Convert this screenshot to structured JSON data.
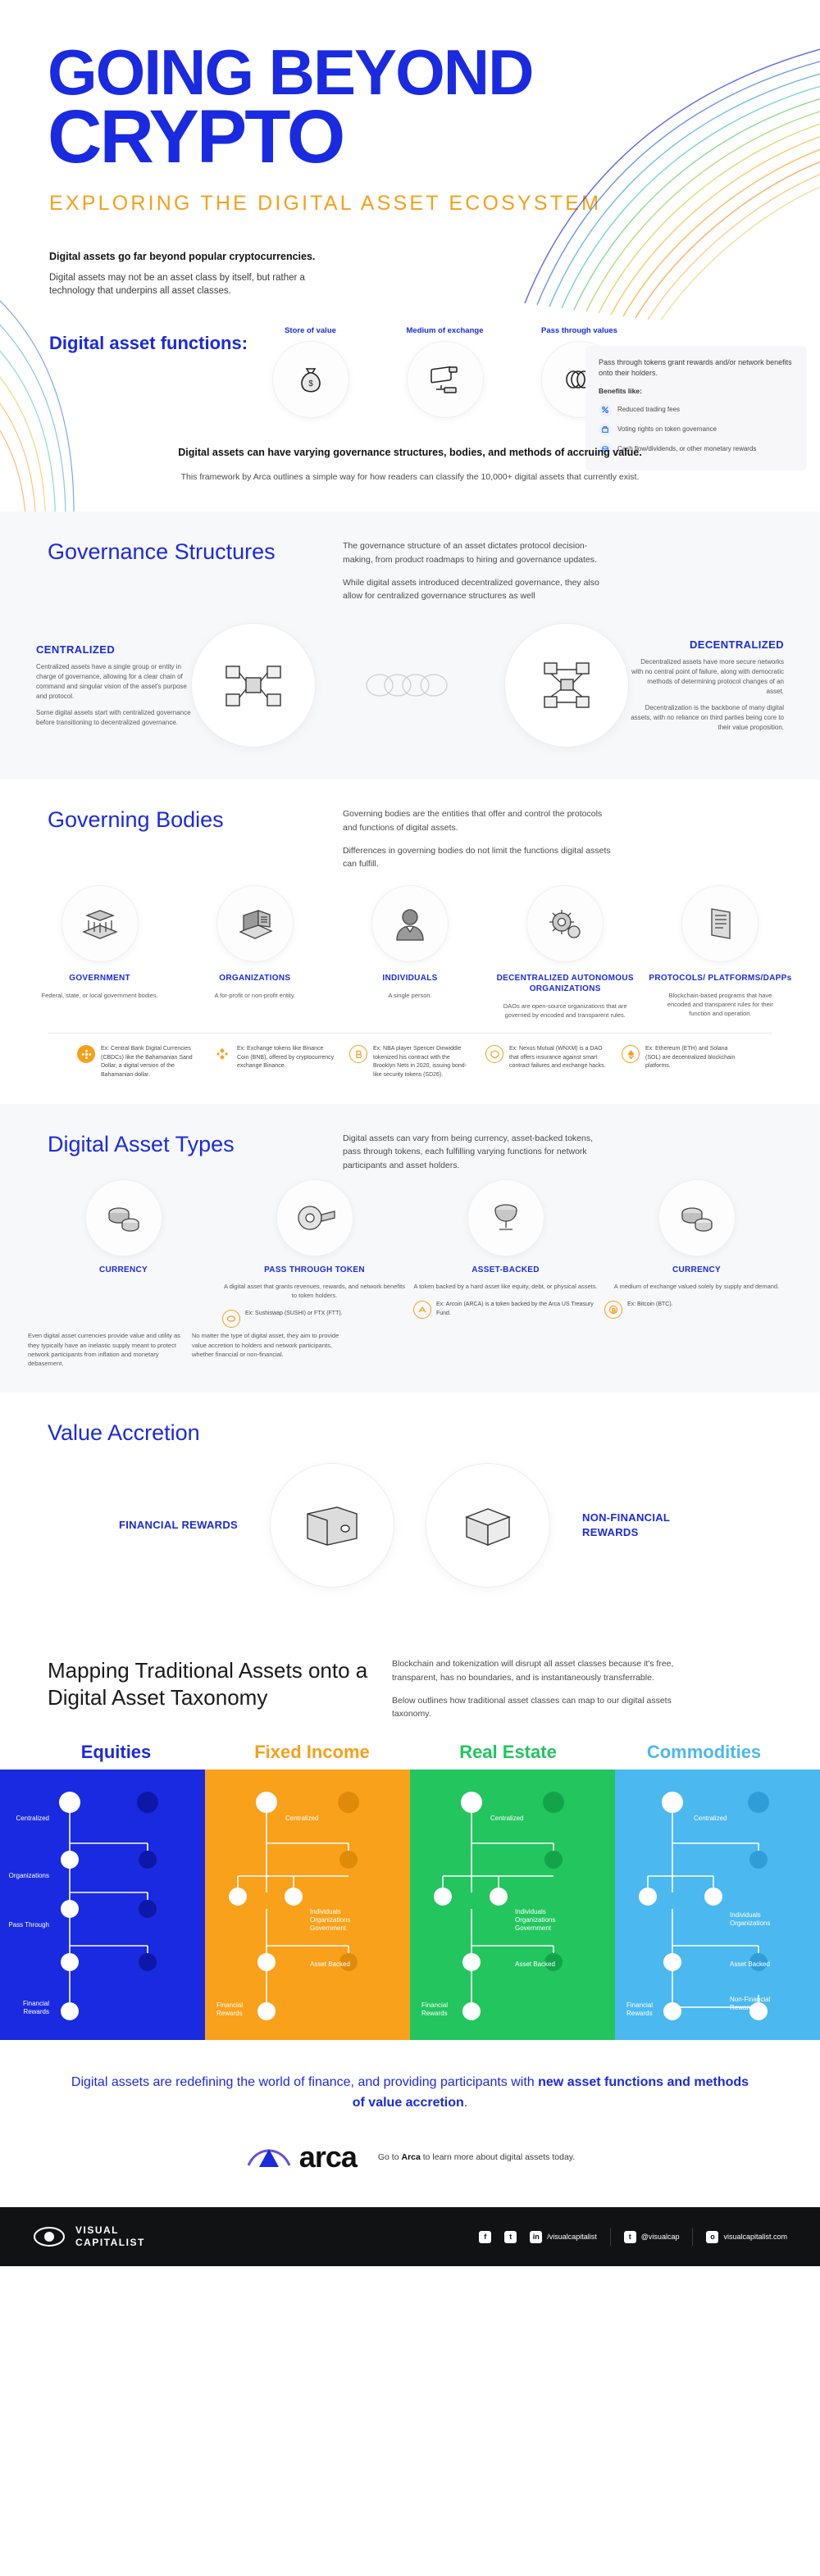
{
  "hero": {
    "title_line1": "GOING BEYOND",
    "title_line2": "CRYPTO",
    "subtitle": "EXPLORING THE DIGITAL ASSET ECOSYSTEM",
    "lead": "Digital assets go far beyond popular cryptocurrencies.",
    "sub": "Digital assets may not be an asset class by itself, but rather a technology that underpins all asset classes."
  },
  "functions": {
    "label": "Digital asset functions:",
    "items": [
      {
        "caption": "Store of value",
        "icon": "money-bag-icon"
      },
      {
        "caption": "Medium of exchange",
        "icon": "monitor-exchange-icon"
      },
      {
        "caption": "Pass through values",
        "icon": "chain-links-icon"
      }
    ],
    "benefits_panel": {
      "head": "Pass through tokens grant rewards and/or network benefits onto their holders.",
      "sub": "Benefits like:",
      "items": [
        {
          "label": "Reduced trading fees",
          "icon": "percent-icon"
        },
        {
          "label": "Voting rights on token governance",
          "icon": "ballot-icon"
        },
        {
          "label": "Cash flow/dividends, or other monetary rewards",
          "icon": "coins-icon"
        }
      ]
    }
  },
  "mid_note": {
    "bold": "Digital assets can have varying governance structures, bodies, and methods of accruing value.",
    "body": "This framework by Arca outlines a simple way for how readers can classify the 10,000+ digital assets that currently exist."
  },
  "governance": {
    "heading": "Governance Structures",
    "desc1": "The governance structure of an asset dictates protocol decision-making, from product roadmaps to hiring and governance updates.",
    "desc2": "While digital assets introduced decentralized governance, they also allow for centralized governance structures as well",
    "left": {
      "title": "CENTRALIZED",
      "p1": "Centralized assets have a single group or entity in charge of governance, allowing for a clear chain of command and singular vision of the asset's purpose and protocol.",
      "p2": "Some digital assets start with centralized governance before transitioning to decentralized governance."
    },
    "right": {
      "title": "DECENTRALIZED",
      "p1": "Decentralized assets have more secure networks with no central point of failure, along with democratic methods of determining protocol changes of an asset.",
      "p2": "Decentralization is the backbone of many digital assets, with no reliance on third parties being core to their value proposition."
    }
  },
  "bodies": {
    "heading": "Governing Bodies",
    "desc1": "Governing bodies are the entities that offer and control the protocols and functions of digital assets.",
    "desc2": "Differences in governing bodies do not limit the functions digital assets can fulfill.",
    "columns": [
      {
        "title": "GOVERNMENT",
        "desc": "Federal, state, or local government bodies.",
        "icon": "bank-building-icon",
        "example": "Ex: Central Bank Digital Currencies (CBDCs) like the Bahamanian Sand Dollar, a digital version of the Bahamanian dollar.",
        "example_icon": "sand-dollar-icon"
      },
      {
        "title": "ORGANIZATIONS",
        "desc": "A for-profit or non-profit entity.",
        "icon": "office-building-icon",
        "example": "Ex: Exchange tokens like Binance Coin (BNB), offered by cryptocurrency exchange Binance.",
        "example_icon": "binance-icon"
      },
      {
        "title": "INDIVIDUALS",
        "desc": "A single person.",
        "icon": "person-suit-icon",
        "example": "Ex: NBA player Spencer Dinwiddie tokenized his contract with the Brooklyn Nets in 2020, issuing bond-like security tokens (SD26).",
        "example_icon": "bond-token-icon"
      },
      {
        "title": "DECENTRALIZED AUTONOMOUS ORGANIZATIONS",
        "desc": "DAOs are open-source organizations that are governed by encoded and transparent rules.",
        "icon": "gear-network-icon",
        "example": "Ex: Nexus Mutual (WNXM) is a DAO that offers insurance against smart contract failures and exchange hacks.",
        "example_icon": "nexus-mutual-icon"
      },
      {
        "title": "PROTOCOLS/ PLATFORMS/DAPPs",
        "desc": "Blockchain-based programs that have encoded and transparent rules for their function and operation.",
        "icon": "ledger-blocks-icon",
        "example": "Ex: Ethereum (ETH) and Solana (SOL) are decentralized blockchain platforms.",
        "example_icon": "ethereum-icon"
      }
    ]
  },
  "asset_types": {
    "heading": "Digital Asset Types",
    "desc": "Digital assets can vary from being currency, asset-backed tokens, pass through tokens, each fulfilling varying functions for network participants and asset holders.",
    "columns": [
      {
        "title": "CURRENCY",
        "desc": "",
        "icon": "coins-stack-icon",
        "footnote1": "Even digital asset currencies provide value and utility as they typically have an inelastic supply meant to protect network participants from inflation and monetary debasement.",
        "footnote2": "No matter the type of digital asset, they aim to provide value accretion to holders and network participants, whether financial or non-financial."
      },
      {
        "title": "PASS THROUGH TOKEN",
        "desc": "A digital asset that grants revenues, rewards, and network benefits to token holders.",
        "icon": "pass-through-ring-icon",
        "example": "Ex: Sushiswap (SUSHI) or FTX (FTT).",
        "example_icon": "sushi-icon"
      },
      {
        "title": "ASSET-BACKED",
        "desc": "A token backed by a hard asset like equity, debt, or physical assets.",
        "icon": "asset-backed-icon",
        "example": "Ex: Arcoin (ARCA) is a token backed by the Arca US Treasury Fund.",
        "example_icon": "arcoin-icon"
      },
      {
        "title": "CURRENCY",
        "desc": "A medium of exchange valued solely by supply and demand.",
        "icon": "coins-stack-icon",
        "example": "Ex: Bitcoin (BTC).",
        "example_icon": "bitcoin-icon"
      }
    ]
  },
  "value_accretion": {
    "heading": "Value Accretion",
    "left_label": "FINANCIAL REWARDS",
    "right_label": "NON-FINANCIAL REWARDS",
    "left_icon": "wallet-icon",
    "right_icon": "gift-box-icon"
  },
  "mapping": {
    "heading": "Mapping Traditional Assets onto a Digital Asset Taxonomy",
    "desc1": "Blockchain and tokenization will disrupt all asset classes because it's free, transparent, has no boundaries, and is instantaneously transferrable.",
    "desc2": "Below outlines how traditional asset classes can map to our digital assets taxonomy.",
    "columns": [
      {
        "name": "Equities",
        "color": "#1a2ae0",
        "bg": "#1a2ae0",
        "nodes": [
          "Centralized",
          "Organizations",
          "Pass Through",
          "Financial Rewards"
        ]
      },
      {
        "name": "Fixed Income",
        "color": "#f6a01a",
        "bg": "#f9a11b",
        "nodes": [
          "Centralized",
          "Individuals Organizations Government",
          "Asset Backed",
          "Financial Rewards"
        ]
      },
      {
        "name": "Real Estate",
        "color": "#17c964",
        "bg": "#22c55e",
        "nodes": [
          "Centralized",
          "Individuals Organizations Government",
          "Asset Backed",
          "Financial Rewards"
        ]
      },
      {
        "name": "Commodities",
        "color": "#36b3f2",
        "bg": "#4cb8f0",
        "nodes": [
          "Centralized",
          "Individuals Organizations",
          "Asset Backed",
          "Financial Rewards",
          "Non-Financial Rewards"
        ]
      }
    ]
  },
  "closing": {
    "text_plain_1": "Digital assets are redefining the world of finance, and providing participants with ",
    "text_bold": "new asset functions and methods of value accretion",
    "text_plain_2": ".",
    "brand": "arca",
    "cta_pre": "Go to ",
    "cta_brand": "Arca",
    "cta_post": " to learn more about digital assets today."
  },
  "footer": {
    "logo_line1": "VISUAL",
    "logo_line2": "CAPITALIST",
    "socials": [
      {
        "icon": "facebook-icon",
        "glyph": "f",
        "handle": ""
      },
      {
        "icon": "twitter-icon",
        "glyph": "t",
        "handle": ""
      },
      {
        "icon": "linkedin-icon",
        "glyph": "in",
        "handle": "/visualcapitalist"
      },
      {
        "icon": "twitter-handle-icon",
        "glyph": "t",
        "handle": "@visualcap"
      },
      {
        "icon": "instagram-icon",
        "glyph": "o",
        "handle": "visualcapitalist.com"
      }
    ]
  }
}
